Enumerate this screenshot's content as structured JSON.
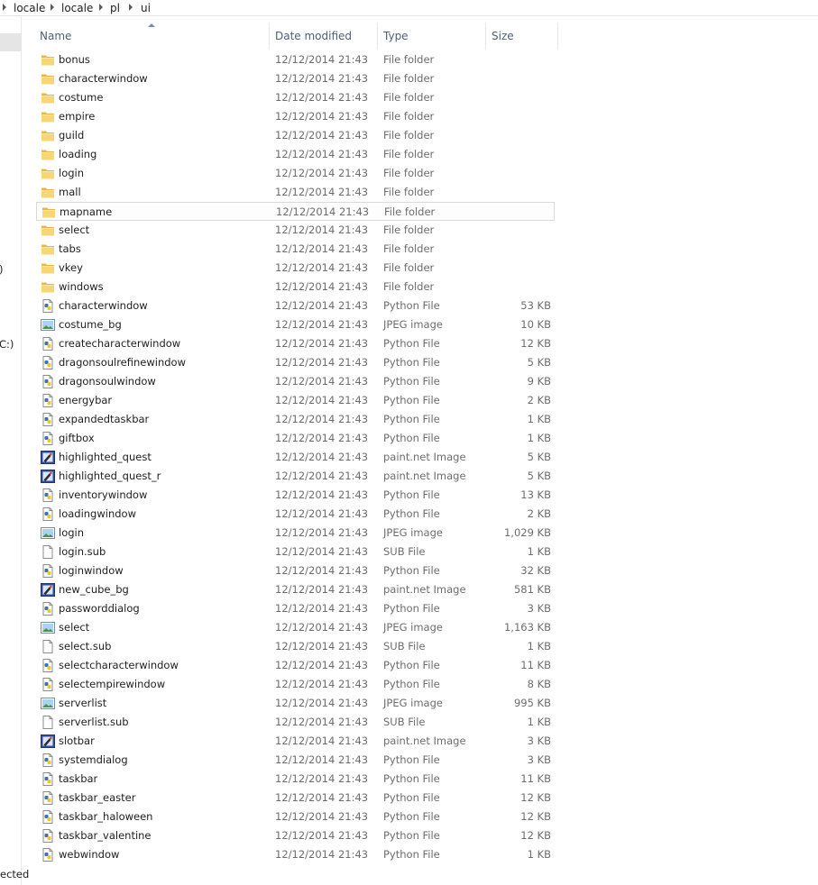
{
  "breadcrumb": [
    "locale",
    "locale",
    "pl",
    "ui"
  ],
  "nav_fragments": [
    ")",
    "C:)"
  ],
  "status_text": "ected",
  "columns": {
    "name": "Name",
    "date": "Date modified",
    "type": "Type",
    "size": "Size"
  },
  "sort": {
    "column": "name",
    "direction": "ascending"
  },
  "highlighted_index": 8,
  "files": [
    {
      "name": "bonus",
      "date": "12/12/2014 21:43",
      "type": "File folder",
      "size": "",
      "icon": "folder-icon"
    },
    {
      "name": "characterwindow",
      "date": "12/12/2014 21:43",
      "type": "File folder",
      "size": "",
      "icon": "folder-icon"
    },
    {
      "name": "costume",
      "date": "12/12/2014 21:43",
      "type": "File folder",
      "size": "",
      "icon": "folder-icon"
    },
    {
      "name": "empire",
      "date": "12/12/2014 21:43",
      "type": "File folder",
      "size": "",
      "icon": "folder-icon"
    },
    {
      "name": "guild",
      "date": "12/12/2014 21:43",
      "type": "File folder",
      "size": "",
      "icon": "folder-icon"
    },
    {
      "name": "loading",
      "date": "12/12/2014 21:43",
      "type": "File folder",
      "size": "",
      "icon": "folder-icon"
    },
    {
      "name": "login",
      "date": "12/12/2014 21:43",
      "type": "File folder",
      "size": "",
      "icon": "folder-icon"
    },
    {
      "name": "mall",
      "date": "12/12/2014 21:43",
      "type": "File folder",
      "size": "",
      "icon": "folder-icon"
    },
    {
      "name": "mapname",
      "date": "12/12/2014 21:43",
      "type": "File folder",
      "size": "",
      "icon": "folder-icon"
    },
    {
      "name": "select",
      "date": "12/12/2014 21:43",
      "type": "File folder",
      "size": "",
      "icon": "folder-icon"
    },
    {
      "name": "tabs",
      "date": "12/12/2014 21:43",
      "type": "File folder",
      "size": "",
      "icon": "folder-icon"
    },
    {
      "name": "vkey",
      "date": "12/12/2014 21:43",
      "type": "File folder",
      "size": "",
      "icon": "folder-icon"
    },
    {
      "name": "windows",
      "date": "12/12/2014 21:43",
      "type": "File folder",
      "size": "",
      "icon": "folder-icon"
    },
    {
      "name": "characterwindow",
      "date": "12/12/2014 21:43",
      "type": "Python File",
      "size": "53 KB",
      "icon": "python-file-icon"
    },
    {
      "name": "costume_bg",
      "date": "12/12/2014 21:43",
      "type": "JPEG image",
      "size": "10 KB",
      "icon": "jpeg-image-icon"
    },
    {
      "name": "createcharacterwindow",
      "date": "12/12/2014 21:43",
      "type": "Python File",
      "size": "12 KB",
      "icon": "python-file-icon"
    },
    {
      "name": "dragonsoulrefinewindow",
      "date": "12/12/2014 21:43",
      "type": "Python File",
      "size": "5 KB",
      "icon": "python-file-icon"
    },
    {
      "name": "dragonsoulwindow",
      "date": "12/12/2014 21:43",
      "type": "Python File",
      "size": "9 KB",
      "icon": "python-file-icon"
    },
    {
      "name": "energybar",
      "date": "12/12/2014 21:43",
      "type": "Python File",
      "size": "2 KB",
      "icon": "python-file-icon"
    },
    {
      "name": "expandedtaskbar",
      "date": "12/12/2014 21:43",
      "type": "Python File",
      "size": "1 KB",
      "icon": "python-file-icon"
    },
    {
      "name": "giftbox",
      "date": "12/12/2014 21:43",
      "type": "Python File",
      "size": "1 KB",
      "icon": "python-file-icon"
    },
    {
      "name": "highlighted_quest",
      "date": "12/12/2014 21:43",
      "type": "paint.net Image",
      "size": "5 KB",
      "icon": "paintnet-image-icon"
    },
    {
      "name": "highlighted_quest_r",
      "date": "12/12/2014 21:43",
      "type": "paint.net Image",
      "size": "5 KB",
      "icon": "paintnet-image-icon"
    },
    {
      "name": "inventorywindow",
      "date": "12/12/2014 21:43",
      "type": "Python File",
      "size": "13 KB",
      "icon": "python-file-icon"
    },
    {
      "name": "loadingwindow",
      "date": "12/12/2014 21:43",
      "type": "Python File",
      "size": "2 KB",
      "icon": "python-file-icon"
    },
    {
      "name": "login",
      "date": "12/12/2014 21:43",
      "type": "JPEG image",
      "size": "1,029 KB",
      "icon": "jpeg-image-icon"
    },
    {
      "name": "login.sub",
      "date": "12/12/2014 21:43",
      "type": "SUB File",
      "size": "1 KB",
      "icon": "blank-file-icon"
    },
    {
      "name": "loginwindow",
      "date": "12/12/2014 21:43",
      "type": "Python File",
      "size": "32 KB",
      "icon": "python-file-icon"
    },
    {
      "name": "new_cube_bg",
      "date": "12/12/2014 21:43",
      "type": "paint.net Image",
      "size": "581 KB",
      "icon": "paintnet-image-icon"
    },
    {
      "name": "passworddialog",
      "date": "12/12/2014 21:43",
      "type": "Python File",
      "size": "3 KB",
      "icon": "python-file-icon"
    },
    {
      "name": "select",
      "date": "12/12/2014 21:43",
      "type": "JPEG image",
      "size": "1,163 KB",
      "icon": "jpeg-image-icon"
    },
    {
      "name": "select.sub",
      "date": "12/12/2014 21:43",
      "type": "SUB File",
      "size": "1 KB",
      "icon": "blank-file-icon"
    },
    {
      "name": "selectcharacterwindow",
      "date": "12/12/2014 21:43",
      "type": "Python File",
      "size": "11 KB",
      "icon": "python-file-icon"
    },
    {
      "name": "selectempirewindow",
      "date": "12/12/2014 21:43",
      "type": "Python File",
      "size": "8 KB",
      "icon": "python-file-icon"
    },
    {
      "name": "serverlist",
      "date": "12/12/2014 21:43",
      "type": "JPEG image",
      "size": "995 KB",
      "icon": "jpeg-image-icon"
    },
    {
      "name": "serverlist.sub",
      "date": "12/12/2014 21:43",
      "type": "SUB File",
      "size": "1 KB",
      "icon": "blank-file-icon"
    },
    {
      "name": "slotbar",
      "date": "12/12/2014 21:43",
      "type": "paint.net Image",
      "size": "3 KB",
      "icon": "paintnet-image-icon"
    },
    {
      "name": "systemdialog",
      "date": "12/12/2014 21:43",
      "type": "Python File",
      "size": "3 KB",
      "icon": "python-file-icon"
    },
    {
      "name": "taskbar",
      "date": "12/12/2014 21:43",
      "type": "Python File",
      "size": "11 KB",
      "icon": "python-file-icon"
    },
    {
      "name": "taskbar_easter",
      "date": "12/12/2014 21:43",
      "type": "Python File",
      "size": "12 KB",
      "icon": "python-file-icon"
    },
    {
      "name": "taskbar_haloween",
      "date": "12/12/2014 21:43",
      "type": "Python File",
      "size": "12 KB",
      "icon": "python-file-icon"
    },
    {
      "name": "taskbar_valentine",
      "date": "12/12/2014 21:43",
      "type": "Python File",
      "size": "12 KB",
      "icon": "python-file-icon"
    },
    {
      "name": "webwindow",
      "date": "12/12/2014 21:43",
      "type": "Python File",
      "size": "1 KB",
      "icon": "python-file-icon"
    }
  ]
}
